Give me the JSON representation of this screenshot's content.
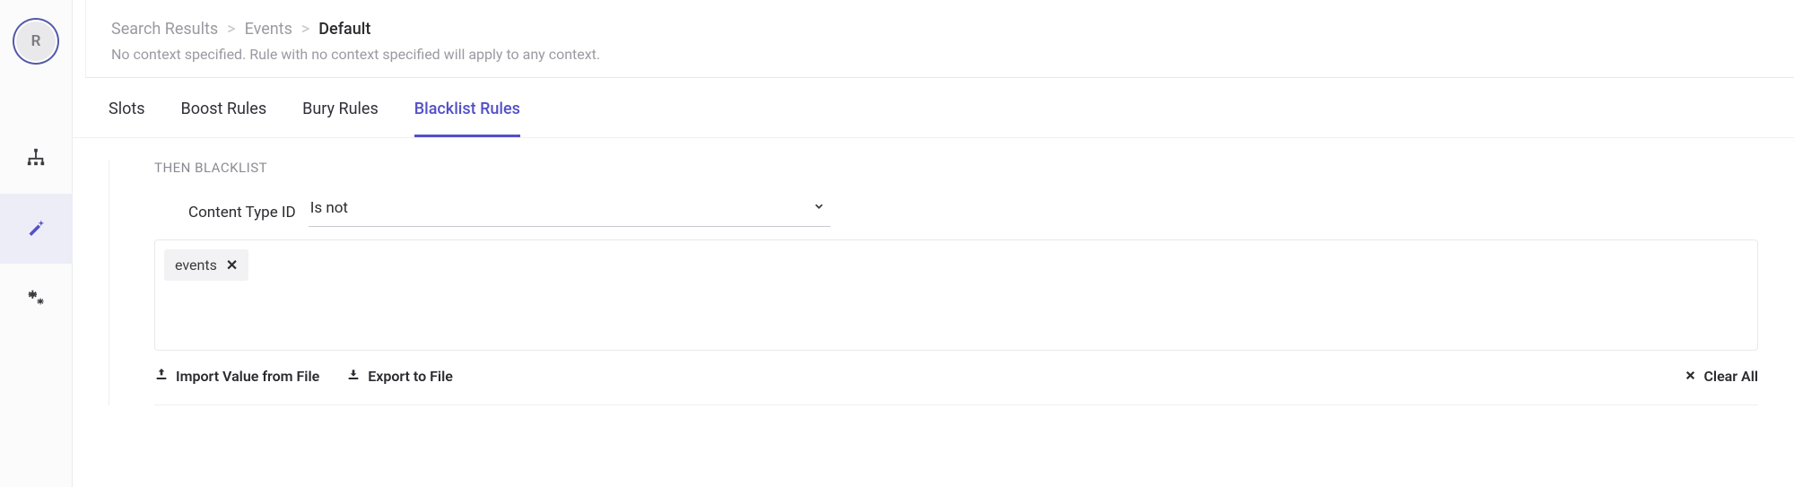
{
  "avatar_letter": "R",
  "breadcrumb": {
    "item0": "Search Results",
    "item1": "Events",
    "current": "Default"
  },
  "subtitle": "No context specified. Rule with no context specified will apply to any context.",
  "tabs": {
    "t0": "Slots",
    "t1": "Boost Rules",
    "t2": "Bury Rules",
    "t3": "Blacklist Rules"
  },
  "rule": {
    "section_header": "THEN BLACKLIST",
    "field_label": "Content Type ID",
    "operator": "Is not",
    "tags": {
      "tag0": "events"
    }
  },
  "actions": {
    "import": "Import Value from File",
    "export": "Export to File",
    "clear": "Clear All"
  }
}
